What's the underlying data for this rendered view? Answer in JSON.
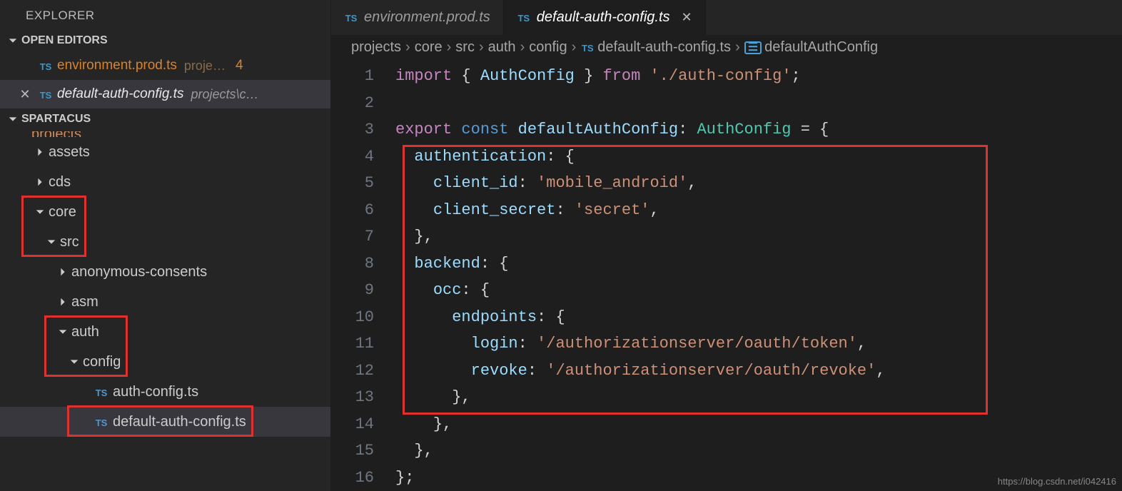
{
  "explorer": {
    "title": "EXPLORER",
    "sections": {
      "open_editors": {
        "label": "OPEN EDITORS",
        "items": [
          {
            "name": "environment.prod.ts",
            "path": "proje…",
            "count": "4"
          },
          {
            "name": "default-auth-config.ts",
            "path": "projects\\c…"
          }
        ]
      },
      "workspace": {
        "label": "SPARTACUS",
        "cut": "projects",
        "tree": [
          {
            "label": "assets",
            "type": "folder-closed",
            "indent": 0
          },
          {
            "label": "cds",
            "type": "folder-closed",
            "indent": 0
          },
          {
            "label": "core",
            "type": "folder-open",
            "indent": 0,
            "box": "a"
          },
          {
            "label": "src",
            "type": "folder-open",
            "indent": 1,
            "box": "a"
          },
          {
            "label": "anonymous-consents",
            "type": "folder-closed",
            "indent": 2
          },
          {
            "label": "asm",
            "type": "folder-closed",
            "indent": 2
          },
          {
            "label": "auth",
            "type": "folder-open",
            "indent": 2,
            "box": "b"
          },
          {
            "label": "config",
            "type": "folder-open",
            "indent": 3,
            "box": "b"
          },
          {
            "label": "auth-config.ts",
            "type": "ts",
            "indent": 4
          },
          {
            "label": "default-auth-config.ts",
            "type": "ts",
            "indent": 4,
            "selected": true,
            "box": "c"
          }
        ]
      }
    }
  },
  "tabs": [
    {
      "label": "environment.prod.ts",
      "active": false
    },
    {
      "label": "default-auth-config.ts",
      "active": true
    }
  ],
  "breadcrumbs": [
    "projects",
    "core",
    "src",
    "auth",
    "config",
    "default-auth-config.ts",
    "defaultAuthConfig"
  ],
  "code": {
    "lines": [
      {
        "n": 1,
        "tokens": [
          [
            "kw",
            "import"
          ],
          [
            "def",
            " "
          ],
          [
            "brace",
            "{"
          ],
          [
            "def",
            " "
          ],
          [
            "var",
            "AuthConfig"
          ],
          [
            "def",
            " "
          ],
          [
            "brace",
            "}"
          ],
          [
            "def",
            " "
          ],
          [
            "kw",
            "from"
          ],
          [
            "def",
            " "
          ],
          [
            "str",
            "'./auth-config'"
          ],
          [
            "punc",
            ";"
          ]
        ]
      },
      {
        "n": 2,
        "tokens": []
      },
      {
        "n": 3,
        "tokens": [
          [
            "kw",
            "export"
          ],
          [
            "def",
            " "
          ],
          [
            "const",
            "const"
          ],
          [
            "def",
            " "
          ],
          [
            "var",
            "defaultAuthConfig"
          ],
          [
            "punc",
            ":"
          ],
          [
            "def",
            " "
          ],
          [
            "type",
            "AuthConfig"
          ],
          [
            "def",
            " "
          ],
          [
            "punc",
            "="
          ],
          [
            "def",
            " "
          ],
          [
            "brace",
            "{"
          ]
        ]
      },
      {
        "n": 4,
        "tokens": [
          [
            "def",
            "  "
          ],
          [
            "prop",
            "authentication"
          ],
          [
            "punc",
            ":"
          ],
          [
            "def",
            " "
          ],
          [
            "brace",
            "{"
          ]
        ]
      },
      {
        "n": 5,
        "tokens": [
          [
            "def",
            "    "
          ],
          [
            "prop",
            "client_id"
          ],
          [
            "punc",
            ":"
          ],
          [
            "def",
            " "
          ],
          [
            "str",
            "'mobile_android'"
          ],
          [
            "punc",
            ","
          ]
        ]
      },
      {
        "n": 6,
        "tokens": [
          [
            "def",
            "    "
          ],
          [
            "prop",
            "client_secret"
          ],
          [
            "punc",
            ":"
          ],
          [
            "def",
            " "
          ],
          [
            "str",
            "'secret'"
          ],
          [
            "punc",
            ","
          ]
        ]
      },
      {
        "n": 7,
        "tokens": [
          [
            "def",
            "  "
          ],
          [
            "brace",
            "}"
          ],
          [
            "punc",
            ","
          ]
        ]
      },
      {
        "n": 8,
        "tokens": [
          [
            "def",
            "  "
          ],
          [
            "prop",
            "backend"
          ],
          [
            "punc",
            ":"
          ],
          [
            "def",
            " "
          ],
          [
            "brace",
            "{"
          ]
        ]
      },
      {
        "n": 9,
        "tokens": [
          [
            "def",
            "    "
          ],
          [
            "prop",
            "occ"
          ],
          [
            "punc",
            ":"
          ],
          [
            "def",
            " "
          ],
          [
            "brace",
            "{"
          ]
        ]
      },
      {
        "n": 10,
        "tokens": [
          [
            "def",
            "      "
          ],
          [
            "prop",
            "endpoints"
          ],
          [
            "punc",
            ":"
          ],
          [
            "def",
            " "
          ],
          [
            "brace",
            "{"
          ]
        ]
      },
      {
        "n": 11,
        "tokens": [
          [
            "def",
            "        "
          ],
          [
            "prop",
            "login"
          ],
          [
            "punc",
            ":"
          ],
          [
            "def",
            " "
          ],
          [
            "str",
            "'/authorizationserver/oauth/token'"
          ],
          [
            "punc",
            ","
          ]
        ]
      },
      {
        "n": 12,
        "tokens": [
          [
            "def",
            "        "
          ],
          [
            "prop",
            "revoke"
          ],
          [
            "punc",
            ":"
          ],
          [
            "def",
            " "
          ],
          [
            "str",
            "'/authorizationserver/oauth/revoke'"
          ],
          [
            "punc",
            ","
          ]
        ]
      },
      {
        "n": 13,
        "tokens": [
          [
            "def",
            "      "
          ],
          [
            "brace",
            "}"
          ],
          [
            "punc",
            ","
          ]
        ]
      },
      {
        "n": 14,
        "tokens": [
          [
            "def",
            "    "
          ],
          [
            "brace",
            "}"
          ],
          [
            "punc",
            ","
          ]
        ]
      },
      {
        "n": 15,
        "tokens": [
          [
            "def",
            "  "
          ],
          [
            "brace",
            "}"
          ],
          [
            "punc",
            ","
          ]
        ]
      },
      {
        "n": 16,
        "tokens": [
          [
            "brace",
            "}"
          ],
          [
            "punc",
            ";"
          ]
        ]
      }
    ],
    "visible_last": 16
  },
  "watermark": "https://blog.csdn.net/i042416"
}
